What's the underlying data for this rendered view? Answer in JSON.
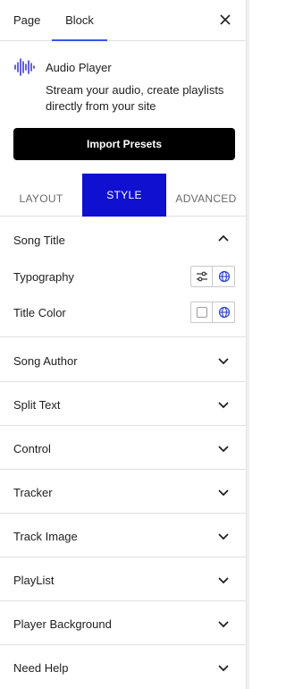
{
  "top_tabs": {
    "page": "Page",
    "block": "Block",
    "active": "Block"
  },
  "block": {
    "name": "Audio Player",
    "description": "Stream your audio, create playlists directly from your site",
    "import_button": "Import Presets",
    "icon": "waveform-icon"
  },
  "style_tabs": {
    "layout": "LAYOUT",
    "style": "STYLE",
    "advanced": "ADVANCED",
    "active": "STYLE"
  },
  "song_title": {
    "title": "Song Title",
    "expanded": true,
    "typography_label": "Typography",
    "title_color_label": "Title Color"
  },
  "panels": [
    {
      "title": "Song Author"
    },
    {
      "title": "Split Text"
    },
    {
      "title": "Control"
    },
    {
      "title": "Tracker"
    },
    {
      "title": "Track Image"
    },
    {
      "title": "PlayList"
    },
    {
      "title": "Player Background"
    },
    {
      "title": "Need Help"
    }
  ],
  "colors": {
    "accent_tab": "#1010d0",
    "import_button": "#000000",
    "active_underline": "#3858e9"
  }
}
